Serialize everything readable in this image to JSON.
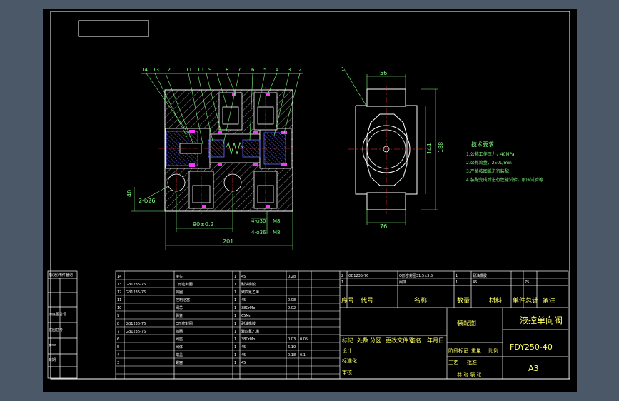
{
  "drawing": {
    "title_block": {
      "part_name": "液控单向阀",
      "part_code": "FDY250-40",
      "drawing_type": "装配图",
      "sheet_size": "A3",
      "headers": [
        "标记",
        "处数",
        "分区",
        "更改文件号",
        "签名",
        "年月日"
      ],
      "extra_labels": [
        "设计",
        "标准化",
        "阶段标记",
        "重量",
        "比例",
        "审核",
        "工艺",
        "批准",
        "共 张 第 张"
      ]
    },
    "bom_columns": [
      "序号",
      "代号",
      "名称",
      "数量",
      "材料",
      "单件",
      "总计",
      "备注"
    ],
    "bom_rows": [
      [
        "14",
        "",
        "接头",
        "1",
        "45",
        "0.28",
        ""
      ],
      [
        "13",
        "GB1235-76",
        "O形密封圈",
        "1",
        "耐油橡胶",
        "",
        ""
      ],
      [
        "12",
        "GB1235-76",
        "挡圈",
        "1",
        "聚四氟乙烯",
        "",
        ""
      ],
      [
        "11",
        "",
        "控制活塞",
        "1",
        "45",
        "0.08",
        ""
      ],
      [
        "10",
        "",
        "阀芯",
        "1",
        "38CrMo",
        "0.02",
        ""
      ],
      [
        "9",
        "",
        "弹簧",
        "1",
        "65Mn",
        "",
        ""
      ],
      [
        "8",
        "GB1235-76",
        "O形密封圈",
        "1",
        "耐油橡胶",
        "",
        ""
      ],
      [
        "7",
        "GB1235-76",
        "挡圈",
        "1",
        "聚四氟乙烯",
        "",
        ""
      ],
      [
        "6",
        "",
        "阀座",
        "1",
        "38CrMo",
        "0.03",
        "0.05"
      ],
      [
        "5",
        "",
        "阀体",
        "1",
        "45",
        "6.10",
        ""
      ],
      [
        "4",
        "",
        "端盖",
        "1",
        "45",
        "0.18",
        "0.1"
      ],
      [
        "3",
        "",
        "螺塞",
        "1",
        "45",
        "",
        ""
      ]
    ],
    "bom_right_rows": [
      [
        "2",
        "GB1235-76",
        "O形密封圈31.5×3.5",
        "1",
        "耐油橡胶",
        "",
        ""
      ],
      [
        "1",
        "",
        "阀体",
        "1",
        "45",
        "",
        "75"
      ]
    ],
    "bom_right_header": [
      "序号",
      "代号",
      "名称",
      "数量",
      "材料",
      "单件",
      "总计",
      "备注"
    ],
    "left_strip_labels": [
      "借(通)用件登记",
      "旧底图总号",
      "底图总号",
      "签字",
      "日期"
    ],
    "technical_requirements": {
      "title": "技术要求",
      "items": [
        "1.公称工作压力，40MPa",
        "2.公称流量，250L/min",
        "3.严格按图纸进行装配",
        "4.装配完成后进行性能试验，耐压试验等."
      ]
    },
    "dimensions": {
      "d56": "56",
      "d188": "188",
      "d144": "144",
      "d76": "76",
      "d40": "40",
      "hole": "2-φ26",
      "d90": "90±0.2",
      "d201": "201",
      "d30": "4-φ30",
      "d36": "4-φ36",
      "tag_m": "M8"
    },
    "balloons": [
      "14",
      "13",
      "12",
      "11",
      "10",
      "9",
      "8",
      "7",
      "6",
      "5",
      "4",
      "3",
      "2",
      "1"
    ],
    "colors": {
      "background": "#000000",
      "app_bg": "#4b5868",
      "outline": "#ffffff",
      "dims": "#7dff7d",
      "section": "#5a5aff",
      "accent": "#ff33ff",
      "text": "#ffff66",
      "center": "#ff3333"
    }
  }
}
